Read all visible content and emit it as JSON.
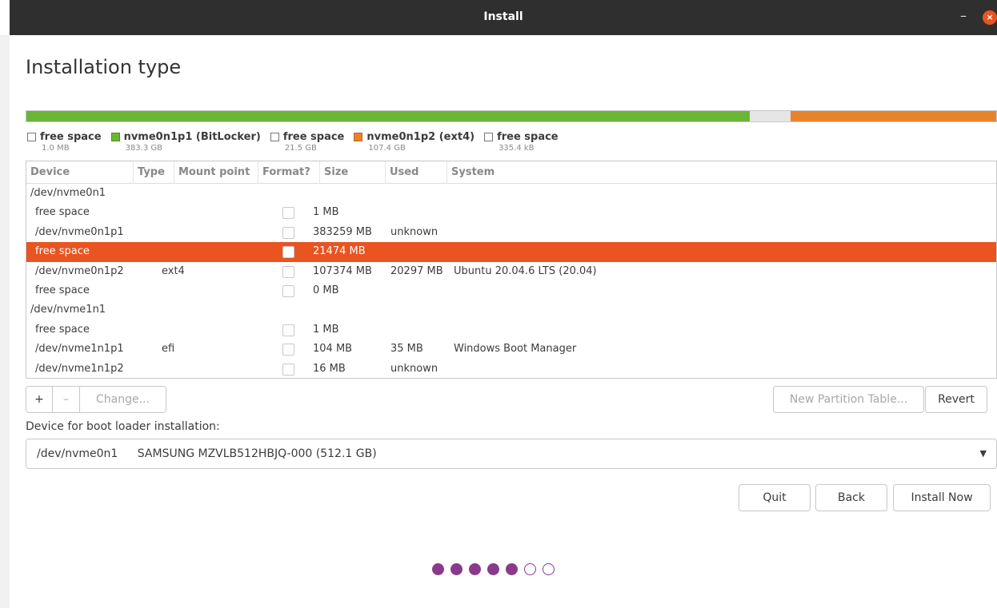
{
  "window": {
    "title": "Install",
    "minimize_glyph": "–",
    "close_glyph": "×"
  },
  "page_title": "Installation type",
  "partition_bar": [
    {
      "color": "#6ab635",
      "fraction": 0.746
    },
    {
      "color": "#e6e6e6",
      "fraction": 0.042
    },
    {
      "color": "#e8832c",
      "fraction": 0.212
    }
  ],
  "legend": [
    {
      "swatch": "empty",
      "label": "free space",
      "size": "1.0 MB"
    },
    {
      "swatch": "green",
      "label": "nvme0n1p1 (BitLocker)",
      "size": "383.3 GB"
    },
    {
      "swatch": "empty",
      "label": "free space",
      "size": "21.5 GB"
    },
    {
      "swatch": "orange",
      "label": "nvme0n1p2 (ext4)",
      "size": "107.4 GB"
    },
    {
      "swatch": "empty",
      "label": "free space",
      "size": "335.4 kB"
    }
  ],
  "table": {
    "headers": [
      "Device",
      "Type",
      "Mount point",
      "Format?",
      "Size",
      "Used",
      "System"
    ],
    "rows": [
      {
        "device": "/dev/nvme0n1",
        "type": "",
        "mount": "",
        "checkbox": false,
        "size": "",
        "used": "",
        "system": "",
        "indent": false,
        "selected": false
      },
      {
        "device": "free space",
        "type": "",
        "mount": "",
        "checkbox": true,
        "size": "1 MB",
        "used": "",
        "system": "",
        "indent": true,
        "selected": false
      },
      {
        "device": "/dev/nvme0n1p1",
        "type": "",
        "mount": "",
        "checkbox": true,
        "size": "383259 MB",
        "used": "unknown",
        "system": "",
        "indent": true,
        "selected": false
      },
      {
        "device": "free space",
        "type": "",
        "mount": "",
        "checkbox": true,
        "size": "21474 MB",
        "used": "",
        "system": "",
        "indent": true,
        "selected": true
      },
      {
        "device": "/dev/nvme0n1p2",
        "type": "ext4",
        "mount": "",
        "checkbox": true,
        "size": "107374 MB",
        "used": "20297 MB",
        "system": "Ubuntu 20.04.6 LTS (20.04)",
        "indent": true,
        "selected": false
      },
      {
        "device": "free space",
        "type": "",
        "mount": "",
        "checkbox": true,
        "size": "0 MB",
        "used": "",
        "system": "",
        "indent": true,
        "selected": false
      },
      {
        "device": "/dev/nvme1n1",
        "type": "",
        "mount": "",
        "checkbox": false,
        "size": "",
        "used": "",
        "system": "",
        "indent": false,
        "selected": false
      },
      {
        "device": "free space",
        "type": "",
        "mount": "",
        "checkbox": true,
        "size": "1 MB",
        "used": "",
        "system": "",
        "indent": true,
        "selected": false
      },
      {
        "device": "/dev/nvme1n1p1",
        "type": "efi",
        "mount": "",
        "checkbox": true,
        "size": "104 MB",
        "used": "35 MB",
        "system": "Windows Boot Manager",
        "indent": true,
        "selected": false
      },
      {
        "device": "/dev/nvme1n1p2",
        "type": "",
        "mount": "",
        "checkbox": true,
        "size": "16 MB",
        "used": "unknown",
        "system": "",
        "indent": true,
        "selected": false
      }
    ]
  },
  "partition_buttons": {
    "add": "+",
    "remove": "–",
    "change": "Change..."
  },
  "new_partition_table_label": "New Partition Table...",
  "revert_label": "Revert",
  "boot_loader": {
    "label": "Device for boot loader installation:",
    "device": "/dev/nvme0n1",
    "description": "SAMSUNG MZVLB512HBJQ-000 (512.1 GB)"
  },
  "nav": {
    "quit": "Quit",
    "back": "Back",
    "install": "Install Now"
  },
  "progress": {
    "total_steps": 7,
    "completed_steps": 5
  },
  "colors": {
    "accent": "#e95420",
    "progress": "#8a3a8a"
  }
}
